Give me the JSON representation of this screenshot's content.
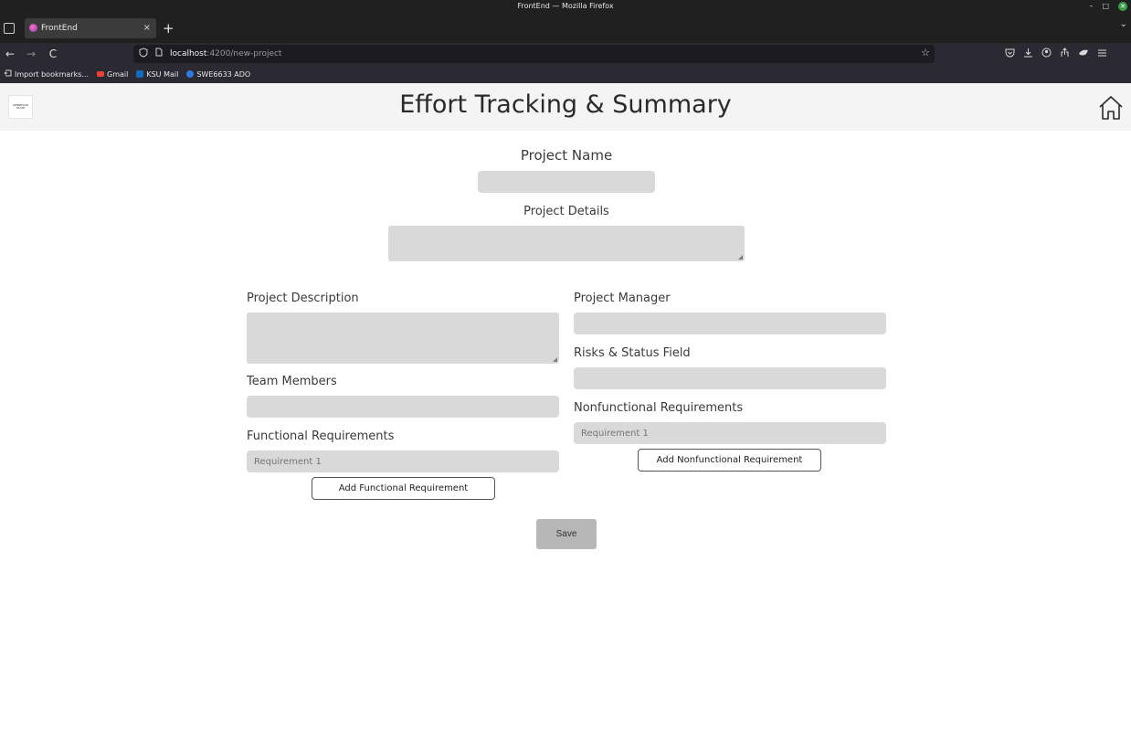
{
  "window": {
    "title": "FrontEnd — Mozilla Firefox",
    "controls": [
      "–",
      "□",
      "✕"
    ]
  },
  "tabs": [
    {
      "label": "FrontEnd",
      "close": "×"
    }
  ],
  "new_tab": "+",
  "tab_overflow": "⌄",
  "nav": {
    "back": "←",
    "forward": "→",
    "reload": "C"
  },
  "address": {
    "host": "localhost",
    "path": ":4200/new-project"
  },
  "bookmarks": [
    {
      "label": "Import bookmarks...",
      "icon": "import-icon",
      "color": "#cfcfcf"
    },
    {
      "label": "Gmail",
      "icon": "gmail-icon",
      "color": "#ea4335"
    },
    {
      "label": "KSU Mail",
      "icon": "outlook-icon",
      "color": "#0f6cbd"
    },
    {
      "label": "SWE6633 ADO",
      "icon": "azure-devops-icon",
      "color": "#2c7be5"
    }
  ],
  "header": {
    "title": "Effort Tracking & Summary",
    "logo_text": "KENNESAW STATE"
  },
  "form": {
    "project_name": {
      "label": "Project Name",
      "value": ""
    },
    "project_details": {
      "label": "Project Details",
      "value": ""
    },
    "project_description": {
      "label": "Project Description",
      "value": ""
    },
    "team_members": {
      "label": "Team Members",
      "value": ""
    },
    "functional_requirements": {
      "label": "Functional Requirements",
      "items": [
        {
          "placeholder": "Requirement 1"
        }
      ],
      "add_label": "Add Functional Requirement"
    },
    "project_manager": {
      "label": "Project Manager",
      "value": ""
    },
    "risks_status": {
      "label": "Risks & Status Field",
      "value": ""
    },
    "nonfunctional_requirements": {
      "label": "Nonfunctional Requirements",
      "items": [
        {
          "placeholder": "Requirement 1"
        }
      ],
      "add_label": "Add Nonfunctional Requirement"
    },
    "save_label": "Save"
  }
}
